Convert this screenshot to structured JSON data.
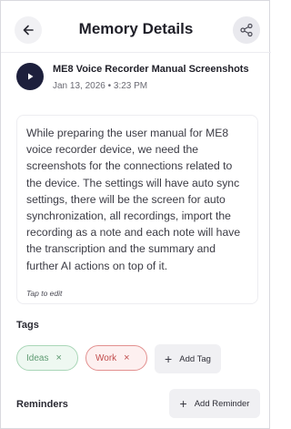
{
  "header": {
    "title": "Memory Details",
    "back_icon": "arrow-left-icon",
    "share_icon": "share-icon"
  },
  "memory": {
    "title": "ME8 Voice Recorder Manual Screenshots",
    "date": "Jan 13, 2026 • 3:23 PM",
    "play_icon": "play-icon",
    "description": "While preparing the user manual for ME8 voice recorder device, we need the screenshots for the connections related to the device. The settings will have auto sync settings, there will be the screen for auto synchronization, all recordings, import the recording as a note and each note will have the transcription and the summary and further AI actions on top of it.",
    "edit_hint": "Tap to edit"
  },
  "tags": {
    "label": "Tags",
    "items": [
      {
        "label": "Ideas",
        "remove": "×",
        "color": "#5e9a72"
      },
      {
        "label": "Work",
        "remove": "×",
        "color": "#c14c4c"
      }
    ],
    "add_label": "Add Tag",
    "add_symbol": "+"
  },
  "reminders": {
    "label": "Reminders",
    "add_label": "Add Reminder",
    "add_symbol": "+"
  },
  "colors": {
    "play_button": "#1d1f3c",
    "surface": "#f0f0f3"
  }
}
